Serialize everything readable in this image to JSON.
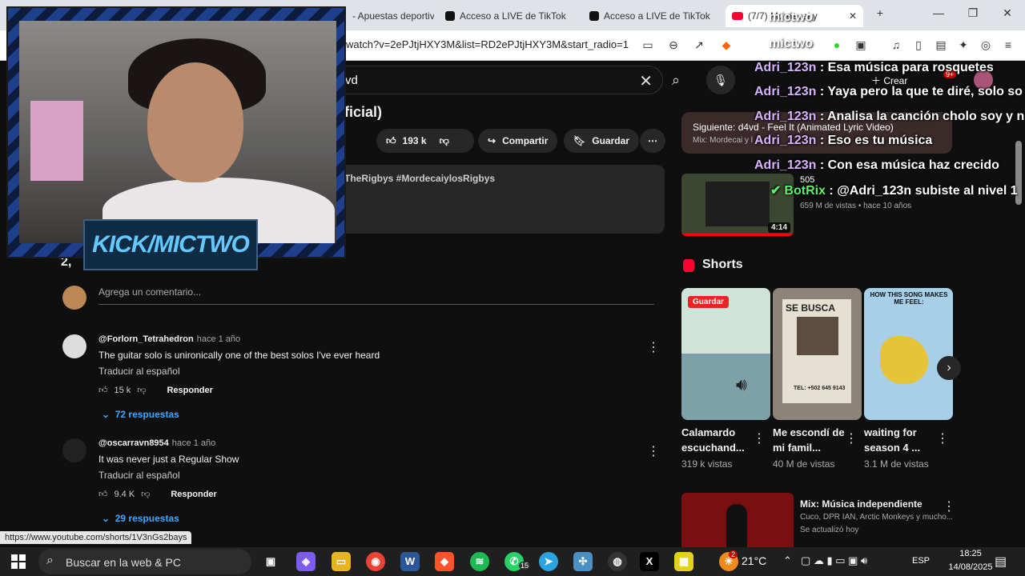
{
  "browser": {
    "tabs": [
      {
        "label": "- Apuestas deportiv"
      },
      {
        "label": "Acceso a LIVE de TikTok"
      },
      {
        "label": "Acceso a LIVE de TikTok"
      },
      {
        "label": "(7/7) Mordecai y"
      }
    ],
    "new_tab": "+",
    "url": "watch?v=2ePJtjHXY3M&list=RD2ePJtjHXY3M&start_radio=1"
  },
  "youtube": {
    "search_value": "vd",
    "video_title": "ficial)",
    "likes": "193 k",
    "share_label": "Compartir",
    "save_label": "Guardar",
    "description_tags": "TheRigbys #MordecaiylosRigbys",
    "comment_count": "2,",
    "add_comment_placeholder": "Agrega un comentario...",
    "comments": [
      {
        "user": "@Forlorn_Tetrahedron",
        "time": "hace 1 año",
        "text": "The guitar solo is unironically one of the best solos I've ever heard",
        "translate": "Traducir al español",
        "likes": "15 k",
        "reply": "Responder",
        "replies": "72 respuestas"
      },
      {
        "user": "@oscarravn8954",
        "time": "hace 1 año",
        "text": "It was never just a Regular Show",
        "translate": "Traducir al español",
        "likes": "9.4 K",
        "reply": "Responder",
        "replies": "29 respuestas"
      }
    ],
    "create_label": "Crear",
    "notif_badge": "9+",
    "next": {
      "label": "Siguiente: d4vd - Feel It (Animated Lyric Video)",
      "sub": "Mix: Mordecai y l"
    },
    "video1": {
      "duration": "4:14",
      "count": "505",
      "meta": "659 M de vistas • hace 10 años"
    },
    "shorts_heading": "Shorts",
    "shorts_save": "Guardar",
    "shorts": [
      {
        "title": "Calamardo escuchand...",
        "views": "319 k vistas",
        "color": "#c9d9c7"
      },
      {
        "title": "Me escondí de mi famil...",
        "views": "40 M de vistas",
        "color": "#8f8576",
        "poster_head": "SE BUSCA",
        "poster_footer": "TEL: +502 645 9143"
      },
      {
        "title": "waiting for season 4 ...",
        "views": "3.1 M de vistas",
        "color": "#9ec8e6",
        "caption": "HOW THIS SONG MAKES ME FEEL:"
      }
    ],
    "mix": {
      "title": "Mix: Música independiente",
      "sub": "Cuco, DPR IAN, Arctic Monkeys y mucho...",
      "updated": "Se actualizó hoy"
    }
  },
  "stream": {
    "channel_label": "KICK/MICTWO",
    "mictwo": "mictwo",
    "chat": [
      {
        "user": "Adri_123n",
        "sep": " : ",
        "msg": "Esa música para rosquetes"
      },
      {
        "user": "Adri_123n",
        "sep": " : ",
        "msg": "Yaya pero la que te diré, solo so"
      },
      {
        "user": "Adri_123n",
        "sep": " : ",
        "msg": "Analisa la canción cholo soy y n"
      },
      {
        "user": "Adri_123n",
        "sep": " : ",
        "msg": "Eso es tu música"
      },
      {
        "user": "Adri_123n",
        "sep": " : ",
        "msg": "Con esa música haz crecido"
      },
      {
        "user": "BotRix",
        "sep": " : ",
        "msg": "@Adri_123n subiste al nivel 1"
      }
    ]
  },
  "status_url": "https://www.youtube.com/shorts/1V3nGs2bays",
  "taskbar": {
    "search_placeholder": "Buscar en la web & PC",
    "temperature": "21°C",
    "language": "ESP",
    "time": "18:25",
    "date": "14/08/2025",
    "whatsapp_badge": "15",
    "weather_badge": "2"
  },
  "colors": {
    "accent_red": "#ff0033",
    "link_blue": "#3ea6ff",
    "chat_bot": "#5ef06a",
    "chat_user": "#d8b4ff",
    "cam_label": "#64c9ff"
  }
}
